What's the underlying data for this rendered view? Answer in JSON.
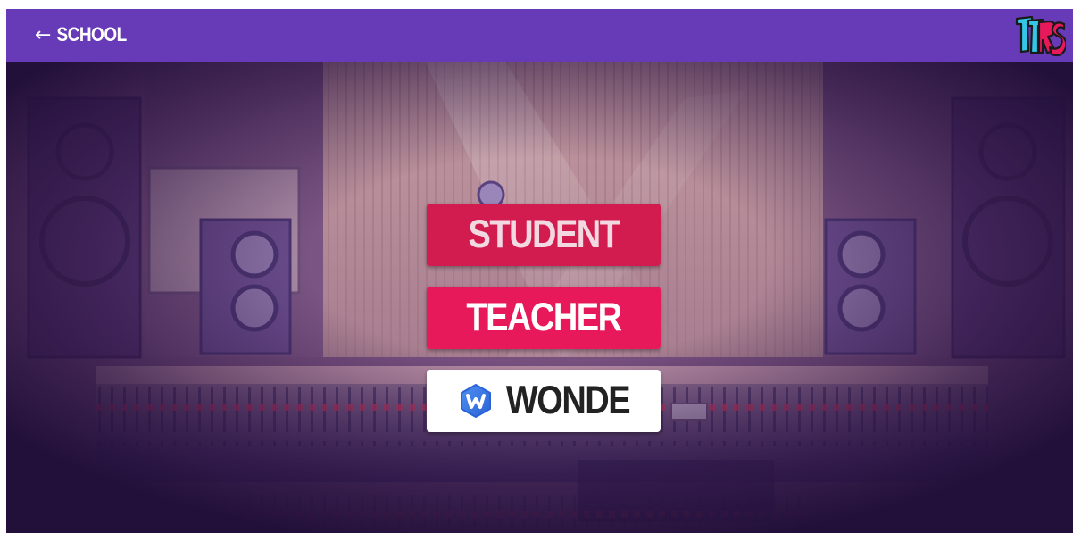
{
  "header": {
    "back_arrow": "←",
    "back_label": "SCHOOL",
    "logo_text": "TTRS",
    "bar_color": "#673ab7"
  },
  "login_options": {
    "student_label": "STUDENT",
    "teacher_label": "TEACHER",
    "wonde_label": "WONDE",
    "student_color": "#d21b4e",
    "teacher_color": "#e8195a",
    "wonde_color": "#ffffff"
  },
  "icons": {
    "wonde_logo": "wonde-logo-icon",
    "logo": "ttrs-logo-icon"
  }
}
